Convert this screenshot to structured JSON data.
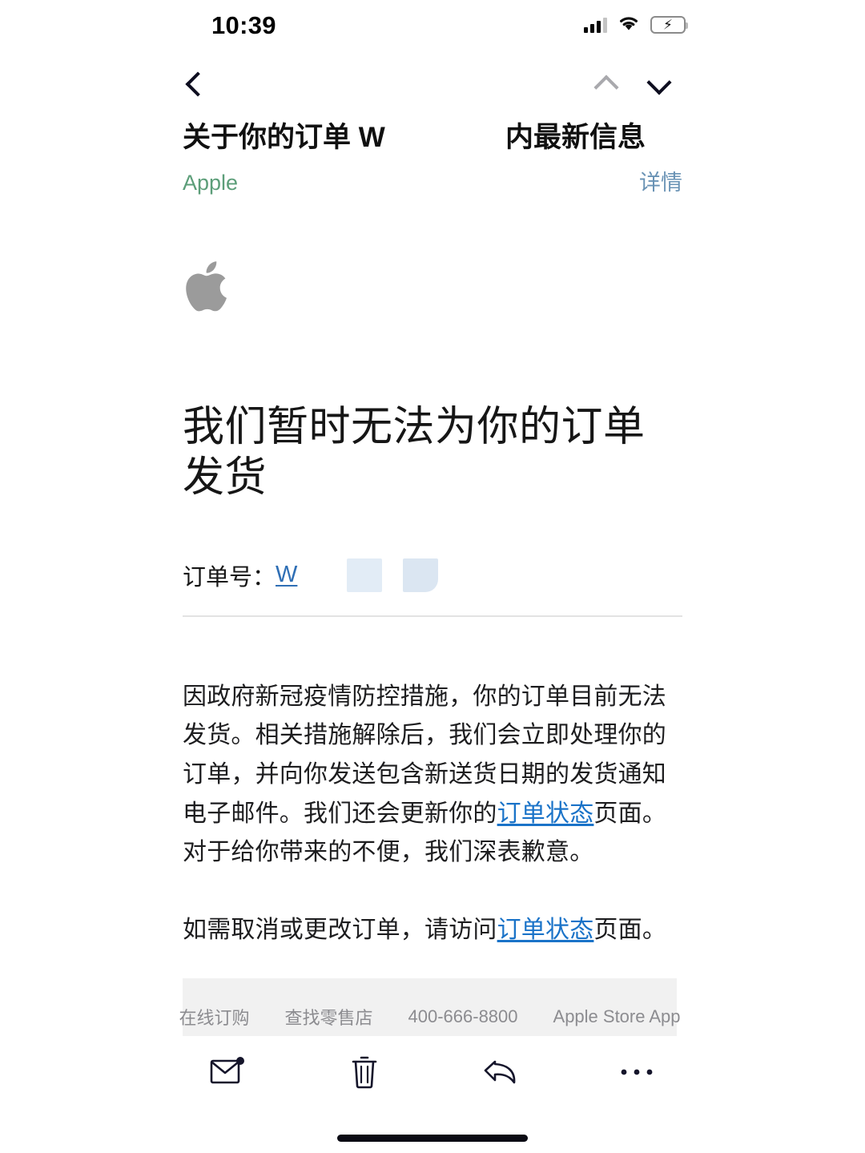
{
  "status_bar": {
    "time": "10:39",
    "signal_icon": "cellular-signal-icon",
    "wifi_icon": "wifi-icon",
    "battery_icon": "battery-charging-icon",
    "battery_color": "#32d04a"
  },
  "nav": {
    "back_icon": "chevron-left-icon",
    "prev_message_icon": "chevron-up-icon",
    "next_message_icon": "chevron-down-icon"
  },
  "mail_header": {
    "subject_part_a": "关于你的订单 W",
    "subject_part_b": "内最新信息",
    "sender": "Apple",
    "sender_color": "#5c9e79",
    "details_label": "详情",
    "details_color": "#6a93b5"
  },
  "email": {
    "brand_logo": "apple-logo-icon",
    "logo_color": "#9b9b9b",
    "headline": "我们暂时无法为你的订单发货",
    "order_label": "订单号：",
    "order_number": "W",
    "order_number_color": "#2f6fb5",
    "paragraph_1": {
      "text_before_link": "因政府新冠疫情防控措施，你的订单目前无法发货。相关措施解除后，我们会立即处理你的订单，并向你发送包含新送货日期的发货通知电子邮件。我们还会更新你的",
      "link_text": "订单状态",
      "text_after_link": "页面。对于给你带来的不便，我们深表歉意。"
    },
    "paragraph_2": {
      "text_before_link": "如需取消或更改订单，请访问",
      "link_text": "订单状态",
      "text_after_link": "页面。"
    },
    "link_color": "#1a73c8"
  },
  "footer": {
    "items": [
      {
        "label": "在线订购"
      },
      {
        "label": "查找零售店"
      },
      {
        "label": "400-666-8800"
      },
      {
        "label": "Apple Store App"
      }
    ],
    "background": "#f1f1f1",
    "text_color": "#8c8c90"
  },
  "toolbar": {
    "buttons": [
      {
        "icon": "mark-unread-envelope-icon",
        "name": "mark-unread-button"
      },
      {
        "icon": "trash-icon",
        "name": "delete-button"
      },
      {
        "icon": "reply-arrow-icon",
        "name": "reply-button"
      },
      {
        "icon": "more-ellipsis-icon",
        "name": "more-button"
      }
    ]
  }
}
